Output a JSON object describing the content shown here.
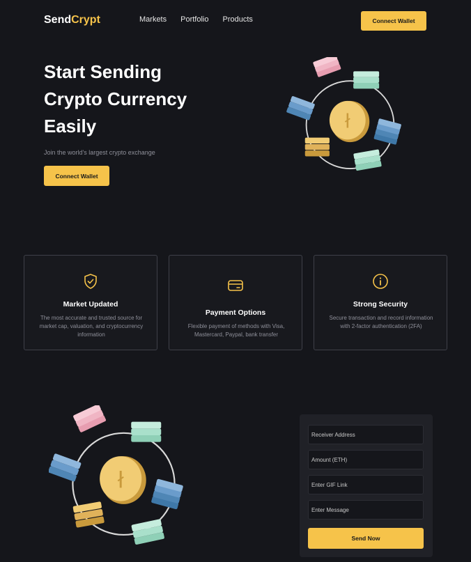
{
  "nav": {
    "logo_main": "Send",
    "logo_accent": "Crypt",
    "links": [
      "Markets",
      "Portfolio",
      "Products"
    ],
    "connect_label": "Connect Wallet"
  },
  "hero": {
    "title": "Start Sending Crypto Currency Easily",
    "subtitle": "Join the world's largest crypto exchange",
    "button_label": "Connect Wallet"
  },
  "features": [
    {
      "icon": "shield-check-icon",
      "title": "Market Updated",
      "text": "The most accurate and trusted source for market cap, valuation, and cryptocurrency information"
    },
    {
      "icon": "credit-card-icon",
      "title": "Payment Options",
      "text": "Flexible payment of methods with Visa, Mastercard, Paypal, bank transfer"
    },
    {
      "icon": "info-icon",
      "title": "Strong Security",
      "text": "Secure transaction and record information with 2-factor authentication (2FA)"
    }
  ],
  "form": {
    "receiver_placeholder": "Receiver Address",
    "amount_placeholder": "Amount (ETH)",
    "gif_placeholder": "Enter GIF Link",
    "message_placeholder": "Enter Message",
    "send_label": "Send Now"
  },
  "colors": {
    "background": "#15161b",
    "accent": "#f6c34a",
    "card_border": "#3f4049",
    "muted_text": "#8f909a"
  }
}
